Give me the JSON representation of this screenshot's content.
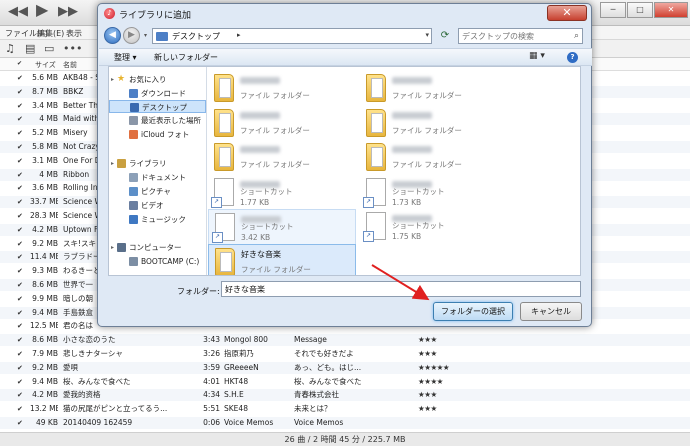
{
  "itunes": {
    "menu": [
      "ファイル(F)",
      "編集(E)",
      "表示"
    ],
    "header": {
      "size": "サイズ",
      "name": "名前"
    },
    "rows": [
      {
        "size": "5.6 MB",
        "name": "AKB48 - S",
        "time": "",
        "artist": "",
        "album": "",
        "rating": ""
      },
      {
        "size": "8.7 MB",
        "name": "BBKZ",
        "time": "",
        "artist": "",
        "album": "",
        "rating": ""
      },
      {
        "size": "3.4 MB",
        "name": "Better Tha",
        "time": "",
        "artist": "",
        "album": "",
        "rating": ""
      },
      {
        "size": "4 MB",
        "name": "Maid with",
        "time": "",
        "artist": "",
        "album": "",
        "rating": ""
      },
      {
        "size": "5.2 MB",
        "name": "Misery",
        "time": "",
        "artist": "",
        "album": "",
        "rating": ""
      },
      {
        "size": "5.8 MB",
        "name": "Not Crazy",
        "time": "",
        "artist": "",
        "album": "",
        "rating": ""
      },
      {
        "size": "3.1 MB",
        "name": "One For D",
        "time": "",
        "artist": "",
        "album": "",
        "rating": ""
      },
      {
        "size": "4 MB",
        "name": "Ribbon",
        "time": "",
        "artist": "",
        "album": "",
        "rating": ""
      },
      {
        "size": "3.6 MB",
        "name": "Rolling In",
        "time": "",
        "artist": "",
        "album": "",
        "rating": ""
      },
      {
        "size": "33.7 MB",
        "name": "Science W",
        "time": "",
        "artist": "",
        "album": "",
        "rating": ""
      },
      {
        "size": "28.3 MB",
        "name": "Science W",
        "time": "",
        "artist": "",
        "album": "",
        "rating": ""
      },
      {
        "size": "4.2 MB",
        "name": "Uptown Fu",
        "time": "",
        "artist": "",
        "album": "",
        "rating": ""
      },
      {
        "size": "9.2 MB",
        "name": "スキ!スキ!",
        "time": "",
        "artist": "",
        "album": "",
        "rating": ""
      },
      {
        "size": "11.4 MB",
        "name": "ラブラドー",
        "time": "",
        "artist": "",
        "album": "",
        "rating": ""
      },
      {
        "size": "9.3 MB",
        "name": "わるきーと",
        "time": "",
        "artist": "",
        "album": "",
        "rating": ""
      },
      {
        "size": "8.6 MB",
        "name": "世界で一",
        "time": "",
        "artist": "",
        "album": "",
        "rating": ""
      },
      {
        "size": "9.9 MB",
        "name": "暗しの朝",
        "time": "",
        "artist": "",
        "album": "",
        "rating": ""
      },
      {
        "size": "9.4 MB",
        "name": "手島鉄盒",
        "time": "",
        "artist": "",
        "album": "",
        "rating": ""
      },
      {
        "size": "12.5 MB",
        "name": "君の名は",
        "time": "",
        "artist": "",
        "album": "",
        "rating": ""
      },
      {
        "size": "8.6 MB",
        "name": "小さな恋のうた",
        "time": "3:43",
        "artist": "Mongol 800",
        "album": "Message",
        "rating": "★★★"
      },
      {
        "size": "7.9 MB",
        "name": "悲しきナターシャ",
        "time": "3:26",
        "artist": "指原莉乃",
        "album": "それでも好きだよ",
        "rating": "★★★"
      },
      {
        "size": "9.2 MB",
        "name": "愛唄",
        "time": "3:59",
        "artist": "GReeeeN",
        "album": "あっ、ども。はじ...",
        "rating": "★★★★★"
      },
      {
        "size": "9.4 MB",
        "name": "桜、みんなで食べた",
        "time": "4:01",
        "artist": "HKT48",
        "album": "桜、みんなで食べた",
        "rating": "★★★★"
      },
      {
        "size": "4.2 MB",
        "name": "愛我的资格",
        "time": "4:34",
        "artist": "S.H.E",
        "album": "青春株式会社",
        "rating": "★★★"
      },
      {
        "size": "13.2 MB",
        "name": "猫の尻尾がピンと立ってるう...",
        "time": "5:51",
        "artist": "SKE48",
        "album": "未来とは？",
        "rating": "★★★"
      },
      {
        "size": "49 KB",
        "name": "20140409 162459",
        "time": "0:06",
        "artist": "Voice Memos",
        "album": "Voice Memos",
        "rating": ""
      }
    ],
    "status": "26 曲 / 2 時間 45 分 / 225.7 MB"
  },
  "dialog": {
    "title": "ライブラリに追加",
    "address": "デスクトップ",
    "search_placeholder": "デスクトップの検索",
    "organize": "整理 ▾",
    "new_folder": "新しいフォルダー",
    "nav": [
      {
        "label": "お気に入り",
        "icon": "star-icon",
        "indent": 0,
        "selected": false
      },
      {
        "label": "ダウンロード",
        "icon": "downloads-folder-icon",
        "indent": 1,
        "selected": false
      },
      {
        "label": "デスクトップ",
        "icon": "desktop-icon",
        "indent": 1,
        "selected": true
      },
      {
        "label": "最近表示した場所",
        "icon": "recent-places-icon",
        "indent": 1,
        "selected": false
      },
      {
        "label": "iCloud フォト",
        "icon": "icloud-photos-icon",
        "indent": 1,
        "selected": false
      },
      {
        "label": "ライブラリ",
        "icon": "library-icon",
        "indent": 0,
        "selected": false
      },
      {
        "label": "ドキュメント",
        "icon": "documents-icon",
        "indent": 1,
        "selected": false
      },
      {
        "label": "ピクチャ",
        "icon": "pictures-icon",
        "indent": 1,
        "selected": false
      },
      {
        "label": "ビデオ",
        "icon": "videos-icon",
        "indent": 1,
        "selected": false
      },
      {
        "label": "ミュージック",
        "icon": "music-icon",
        "indent": 1,
        "selected": false
      },
      {
        "label": "コンピューター",
        "icon": "computer-icon",
        "indent": 0,
        "selected": false
      },
      {
        "label": "BOOTCAMP (C:)",
        "icon": "drive-icon",
        "indent": 1,
        "selected": false
      }
    ],
    "files": [
      {
        "name": "",
        "sub": "ファイル フォルダー",
        "kind": "folder",
        "state": ""
      },
      {
        "name": "",
        "sub": "ファイル フォルダー",
        "kind": "folder",
        "state": ""
      },
      {
        "name": "",
        "sub": "ファイル フォルダー",
        "kind": "folder",
        "state": ""
      },
      {
        "name": "",
        "sub": "ファイル フォルダー",
        "kind": "folder",
        "state": ""
      },
      {
        "name": "",
        "sub": "ファイル フォルダー",
        "kind": "folder",
        "state": ""
      },
      {
        "name": "",
        "sub": "ファイル フォルダー",
        "kind": "folder",
        "state": ""
      },
      {
        "name": "",
        "sub": "ショートカット\n1.77 KB",
        "kind": "shortcut",
        "state": ""
      },
      {
        "name": "",
        "sub": "ショートカット\n1.73 KB",
        "kind": "shortcut",
        "state": ""
      },
      {
        "name": "",
        "sub": "ショートカット\n3.42 KB",
        "kind": "shortcut",
        "state": "hov"
      },
      {
        "name": "",
        "sub": "ショートカット\n1.75 KB",
        "kind": "shortcut",
        "state": ""
      },
      {
        "name": "好きな音楽",
        "sub": "ファイル フォルダー",
        "kind": "folder",
        "state": "sel"
      }
    ],
    "filename_label": "フォルダー:",
    "filename_value": "好きな音楽",
    "select_button": "フォルダーの選択",
    "cancel_button": "キャンセル"
  },
  "colors": {
    "arrow": "#e02020",
    "selection": "#cde4fb"
  }
}
